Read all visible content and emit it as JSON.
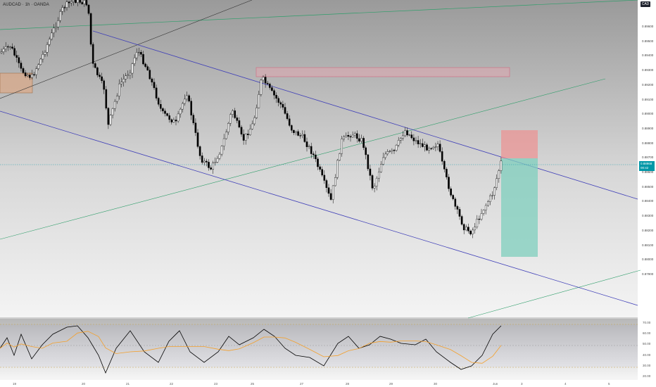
{
  "header": {
    "symbol": "AUDCAD · 1h · OANDA"
  },
  "currency_badge": "CAD",
  "price_axis": {
    "labels": [
      "0.89600",
      "0.89500",
      "0.89400",
      "0.89300",
      "0.89200",
      "0.89100",
      "0.89000",
      "0.88900",
      "0.88800",
      "0.88700",
      "0.88600",
      "0.88500",
      "0.88400",
      "0.88300",
      "0.88200",
      "0.88100",
      "0.88000",
      "0.87900"
    ]
  },
  "current_price": {
    "value": "0.88968",
    "countdown": "00:42"
  },
  "rsi_axis": {
    "labels": [
      "70.00",
      "60.00",
      "50.00",
      "40.00",
      "30.00",
      "20.00"
    ]
  },
  "date_axis": {
    "labels": [
      "19",
      "20",
      "21",
      "22",
      "23",
      "25",
      "27",
      "28",
      "29",
      "30",
      "Jun",
      "3",
      "4",
      "5"
    ]
  },
  "colors": {
    "bull_candle": "#ffffff",
    "bear_candle": "#000000",
    "channel_line": "#3f3fb8",
    "trend_line_green": "#2e9e6a",
    "supply_zone": "#e8a3b0",
    "stop_zone": "#f08c8c",
    "target_zone": "#7fcfbd",
    "rsi_line": "#000000",
    "rsi_ma": "#f4a02c"
  }
}
